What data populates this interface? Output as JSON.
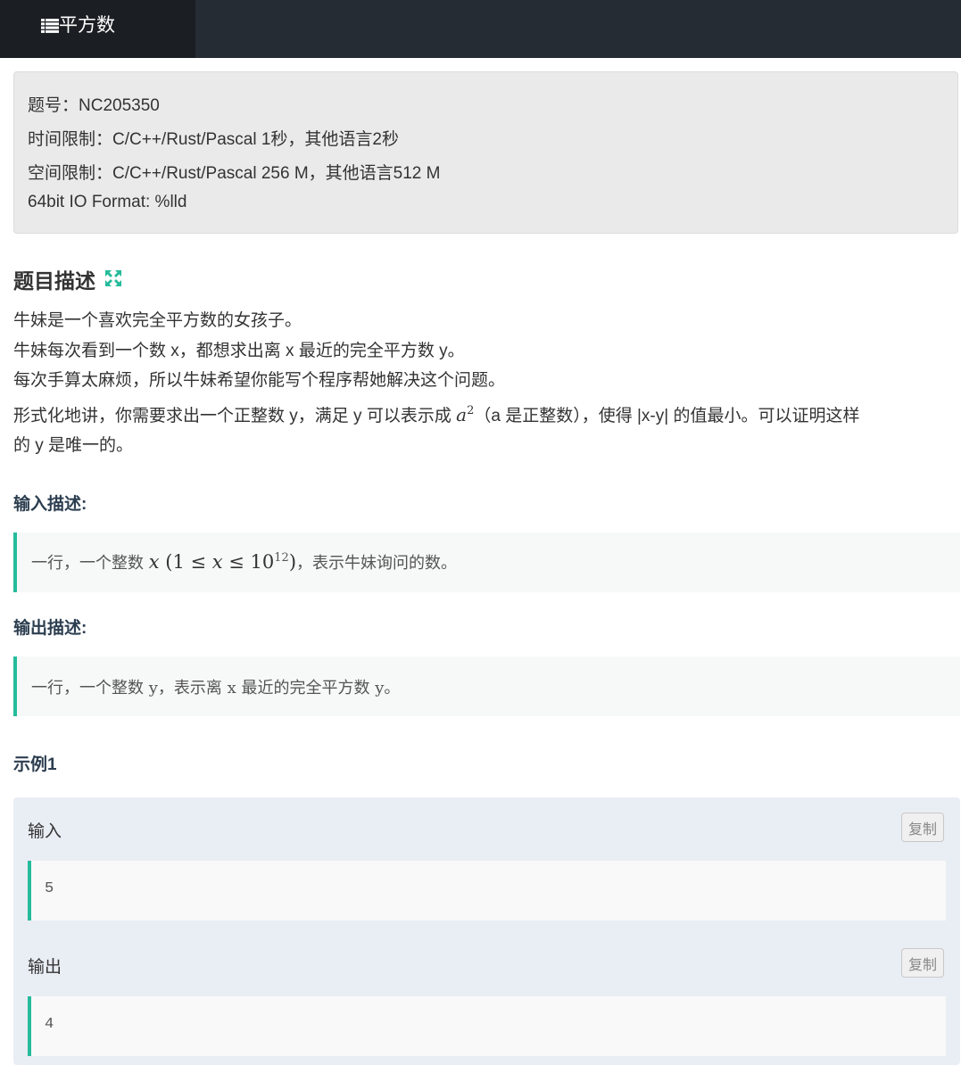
{
  "header": {
    "title": "平方数",
    "icon": "list-icon"
  },
  "info": {
    "problem_id": "题号：NC205350",
    "time_limit": "时间限制：C/C++/Rust/Pascal 1秒，其他语言2秒",
    "memory_limit": "空间限制：C/C++/Rust/Pascal 256 M，其他语言512 M",
    "io_format": "64bit IO Format: %lld"
  },
  "description": {
    "heading": "题目描述",
    "line1": "牛妹是一个喜欢完全平方数的女孩子。",
    "line2": "牛妹每次看到一个数 x，都想求出离 x 最近的完全平方数 y。",
    "line3": "每次手算太麻烦，所以牛妹希望你能写个程序帮她解决这个问题。",
    "line4_a": "形式化地讲，你需要求出一个正整数 y，满足 y 可以表示成 ",
    "line4_var": "a",
    "line4_sup": "2",
    "line4_b": "（a 是正整数），使得 |x-y| 的值最小。可以证明这样",
    "line5": "的 y 是唯一的。"
  },
  "input": {
    "heading": "输入描述:",
    "text_a": "一行，一个整数 ",
    "math_var": "x",
    "math_open": " (1 ≤ ",
    "math_var2": "x",
    "math_le": " ≤ 10",
    "math_sup": "12",
    "math_close": ")",
    "text_b": "，表示牛妹询问的数。"
  },
  "output": {
    "heading": "输出描述:",
    "text": "一行，一个整数 y，表示离 x 最近的完全平方数 y。"
  },
  "example": {
    "heading": "示例1",
    "input_label": "输入",
    "input_value": "5",
    "output_label": "输出",
    "output_value": "4",
    "copy_label": "复制"
  },
  "colors": {
    "accent": "#25bb9b",
    "topbar": "#262c33"
  }
}
